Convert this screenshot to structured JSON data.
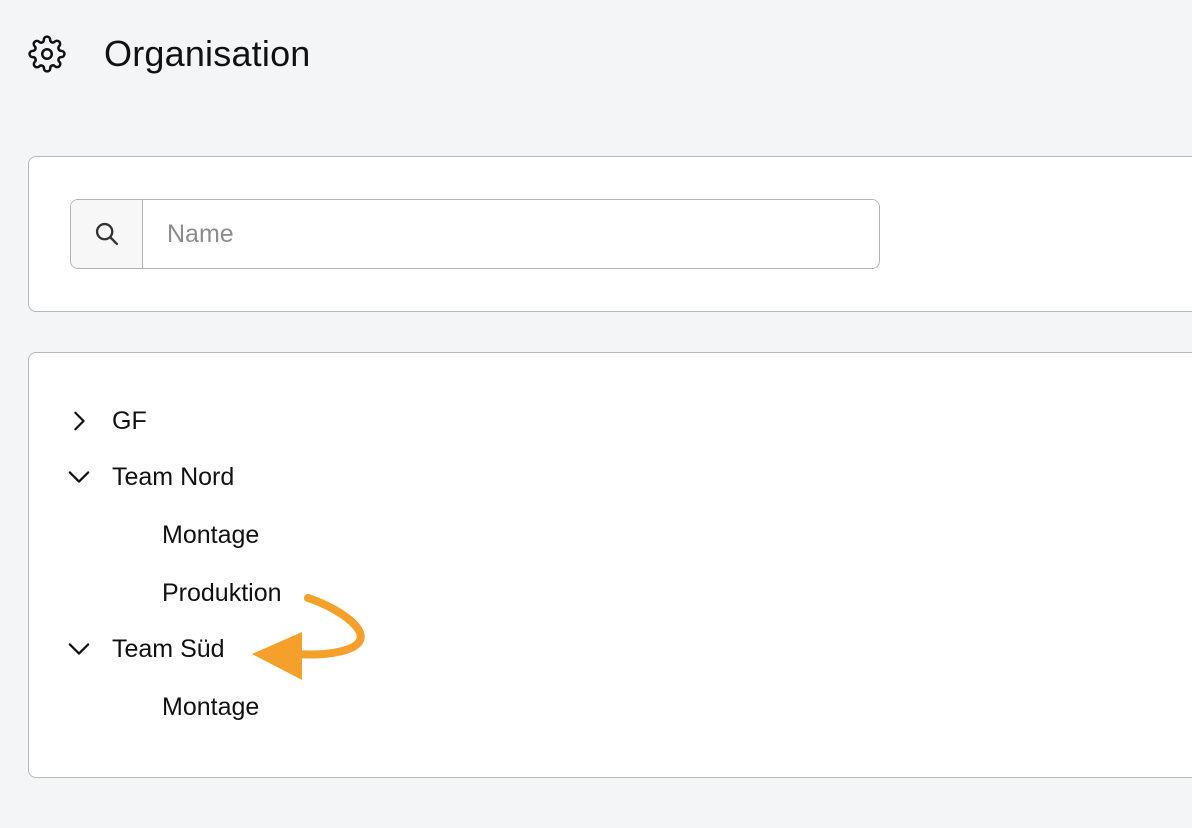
{
  "header": {
    "title": "Organisation",
    "icon": "gear-icon"
  },
  "search": {
    "placeholder": "Name",
    "value": "",
    "icon": "search-icon"
  },
  "tree": {
    "items": [
      {
        "label": "GF",
        "level": 0,
        "expanded": false
      },
      {
        "label": "Team Nord",
        "level": 0,
        "expanded": true
      },
      {
        "label": "Montage",
        "level": 1
      },
      {
        "label": "Produktion",
        "level": 1
      },
      {
        "label": "Team Süd",
        "level": 0,
        "expanded": true
      },
      {
        "label": "Montage",
        "level": 1
      }
    ]
  },
  "annotation": {
    "type": "arrow",
    "color": "#f5a02a",
    "from_item": "Produktion",
    "to_item": "Team Süd"
  }
}
